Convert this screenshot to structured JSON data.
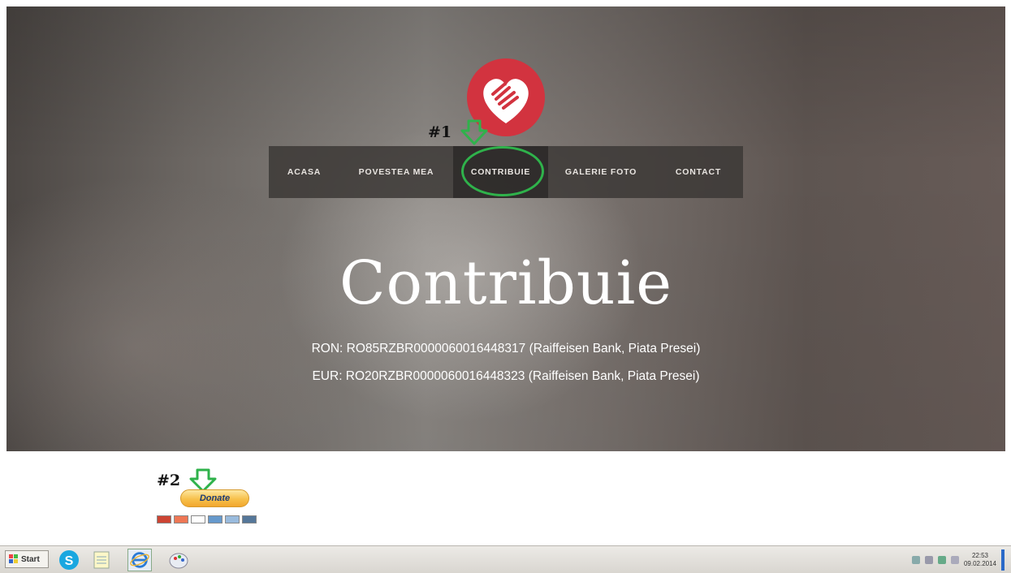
{
  "nav": {
    "items": [
      "ACASA",
      "POVESTEA MEA",
      "CONTRIBUIE",
      "GALERIE FOTO",
      "CONTACT"
    ],
    "active_index": 2
  },
  "annotations": {
    "label1": "#1",
    "label2": "#2"
  },
  "hero": {
    "title": "Contribuie",
    "bank_lines": [
      "RON: RO85RZBR0000060016448317 (Raiffeisen Bank, Piata Presei)",
      "EUR: RO20RZBR0000060016448323 (Raiffeisen Bank, Piata Presei)"
    ]
  },
  "donate": {
    "label": "Donate"
  },
  "taskbar": {
    "start_label": "Start",
    "clock_time": "22:53",
    "clock_date": "09.02.2014"
  },
  "colors": {
    "logo_red": "#d2333f",
    "annotation_green": "#2fb24b",
    "donate_gold": "#f7c04b"
  },
  "icons": [
    "heart-handshake-icon",
    "down-arrow-icon",
    "skype-icon",
    "notepad-icon",
    "internet-explorer-icon",
    "paint-icon"
  ]
}
